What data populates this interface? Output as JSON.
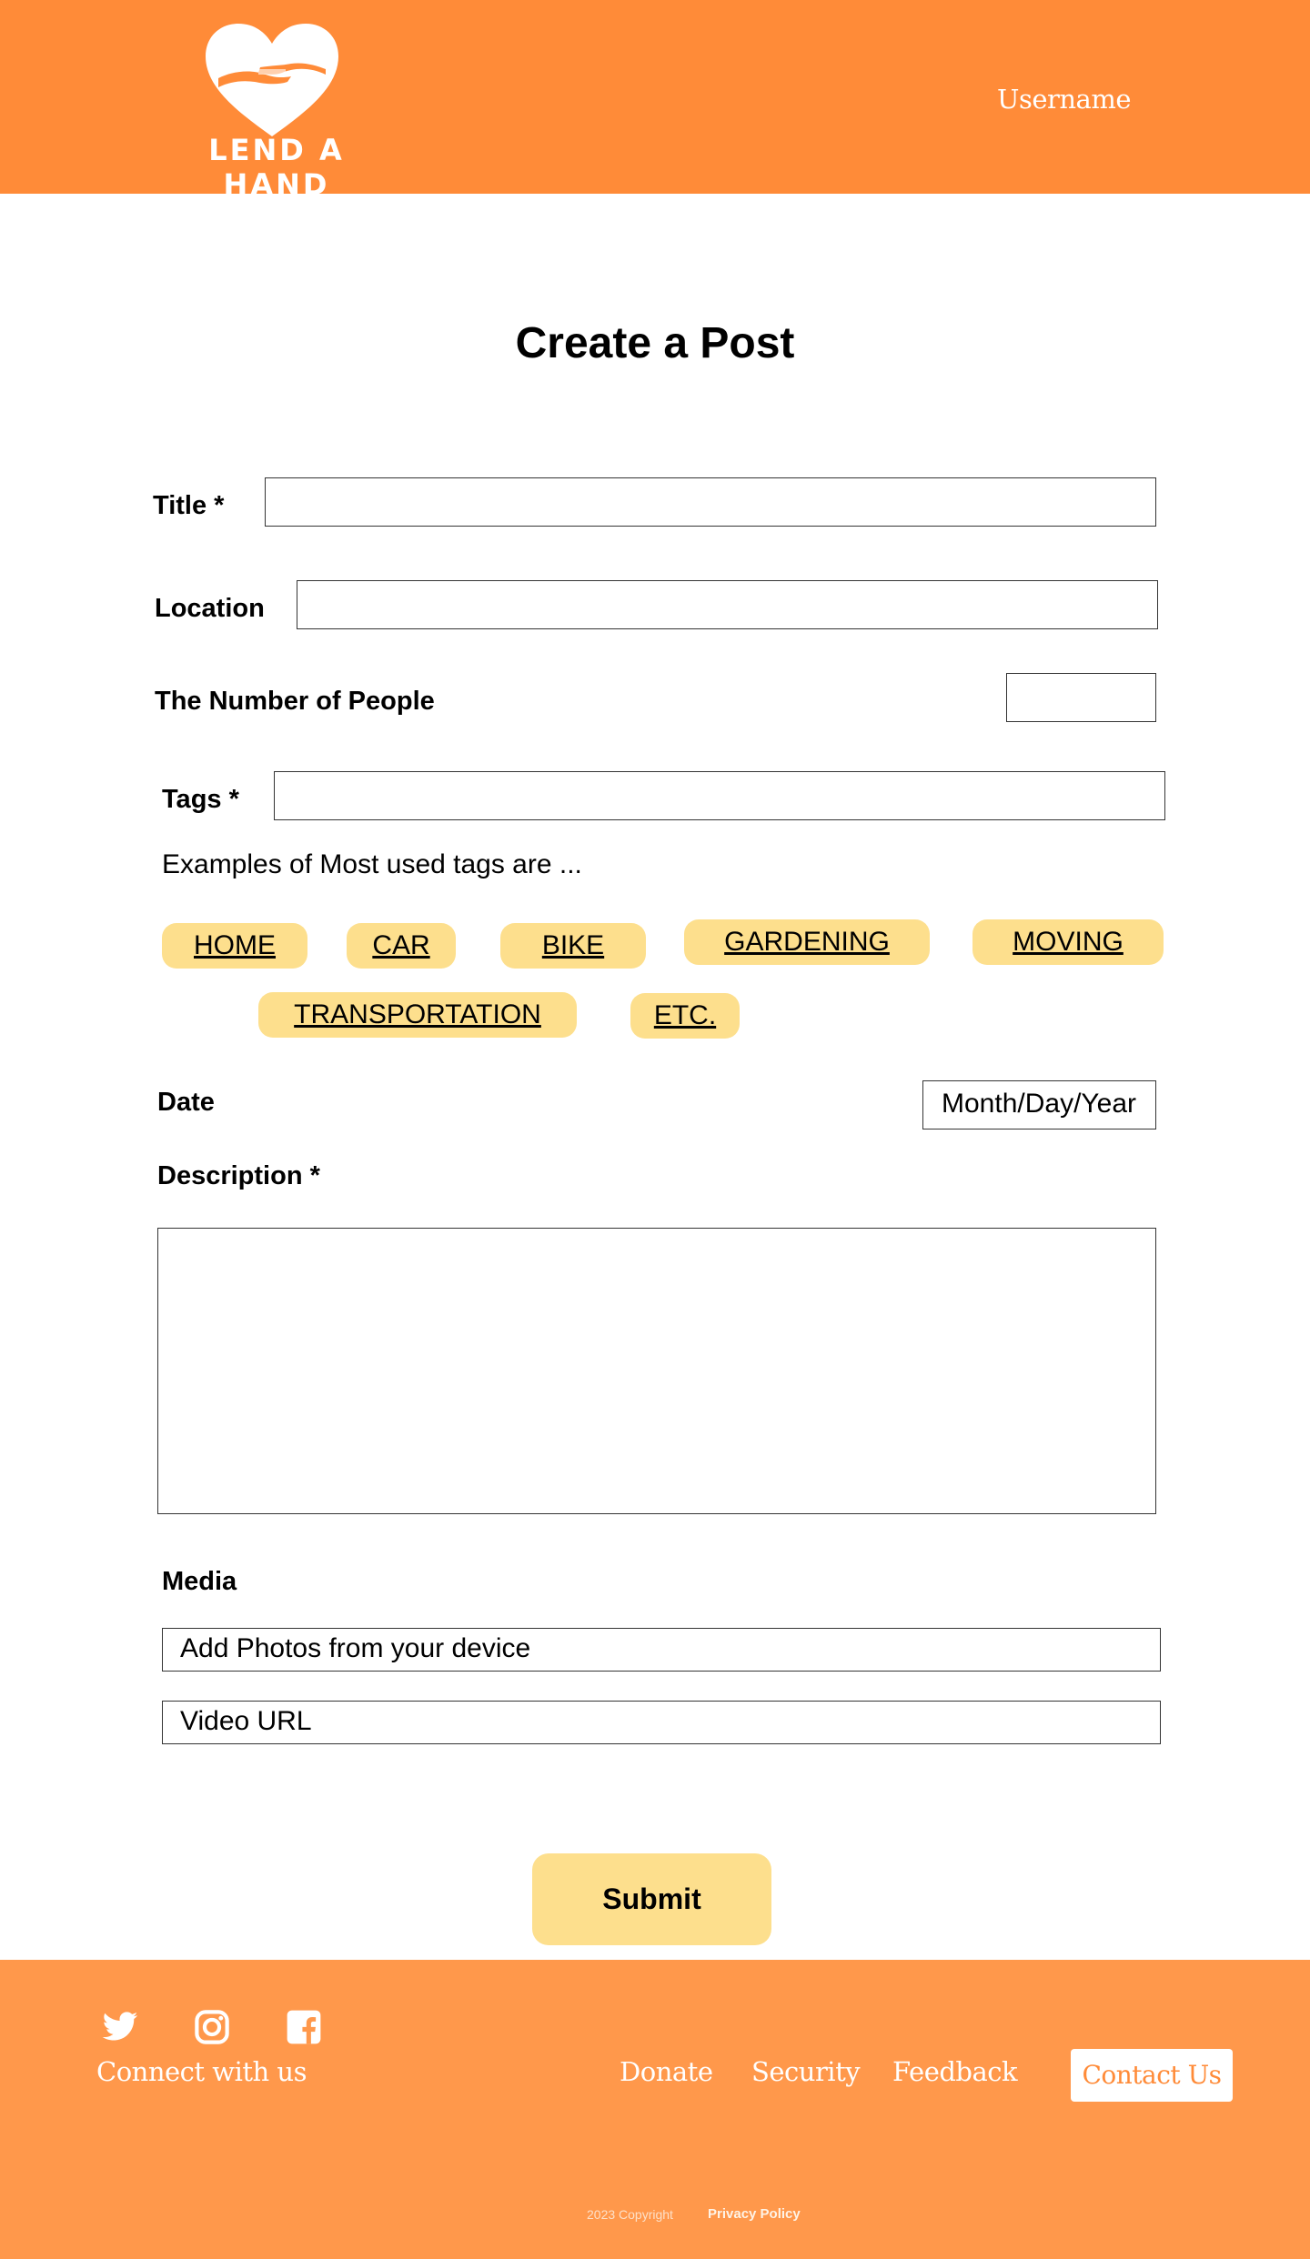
{
  "header": {
    "logo_text": "LEND A HAND",
    "username": "Username",
    "colors": {
      "background": "#ff8b38",
      "text": "#ffffff"
    }
  },
  "main": {
    "title": "Create a Post",
    "fields": {
      "title_label": "Title *",
      "location_label": "Location",
      "people_label": "The Number of People",
      "tags_label": "Tags *",
      "tags_hint": "Examples of Most used tags are ...",
      "date_label": "Date",
      "date_placeholder": "Month/Day/Year",
      "description_label": "Description *",
      "media_label": "Media",
      "photos_placeholder": "Add Photos from your device",
      "video_placeholder": "Video URL"
    },
    "tags": [
      "HOME",
      "CAR",
      "BIKE",
      "GARDENING",
      "MOVING",
      "TRANSPORTATION",
      "ETC."
    ],
    "submit_label": "Submit",
    "colors": {
      "tag": "#fddf8d",
      "submit": "#fddf8d"
    }
  },
  "footer": {
    "social_icons": [
      "twitter-icon",
      "instagram-icon",
      "facebook-icon"
    ],
    "connect_label": "Connect with us",
    "links": [
      "Donate",
      "Security",
      "Feedback"
    ],
    "contact_label": "Contact Us",
    "copyright": "2023 Copyright",
    "privacy": "Privacy Policy",
    "colors": {
      "background": "#ff984b"
    }
  }
}
